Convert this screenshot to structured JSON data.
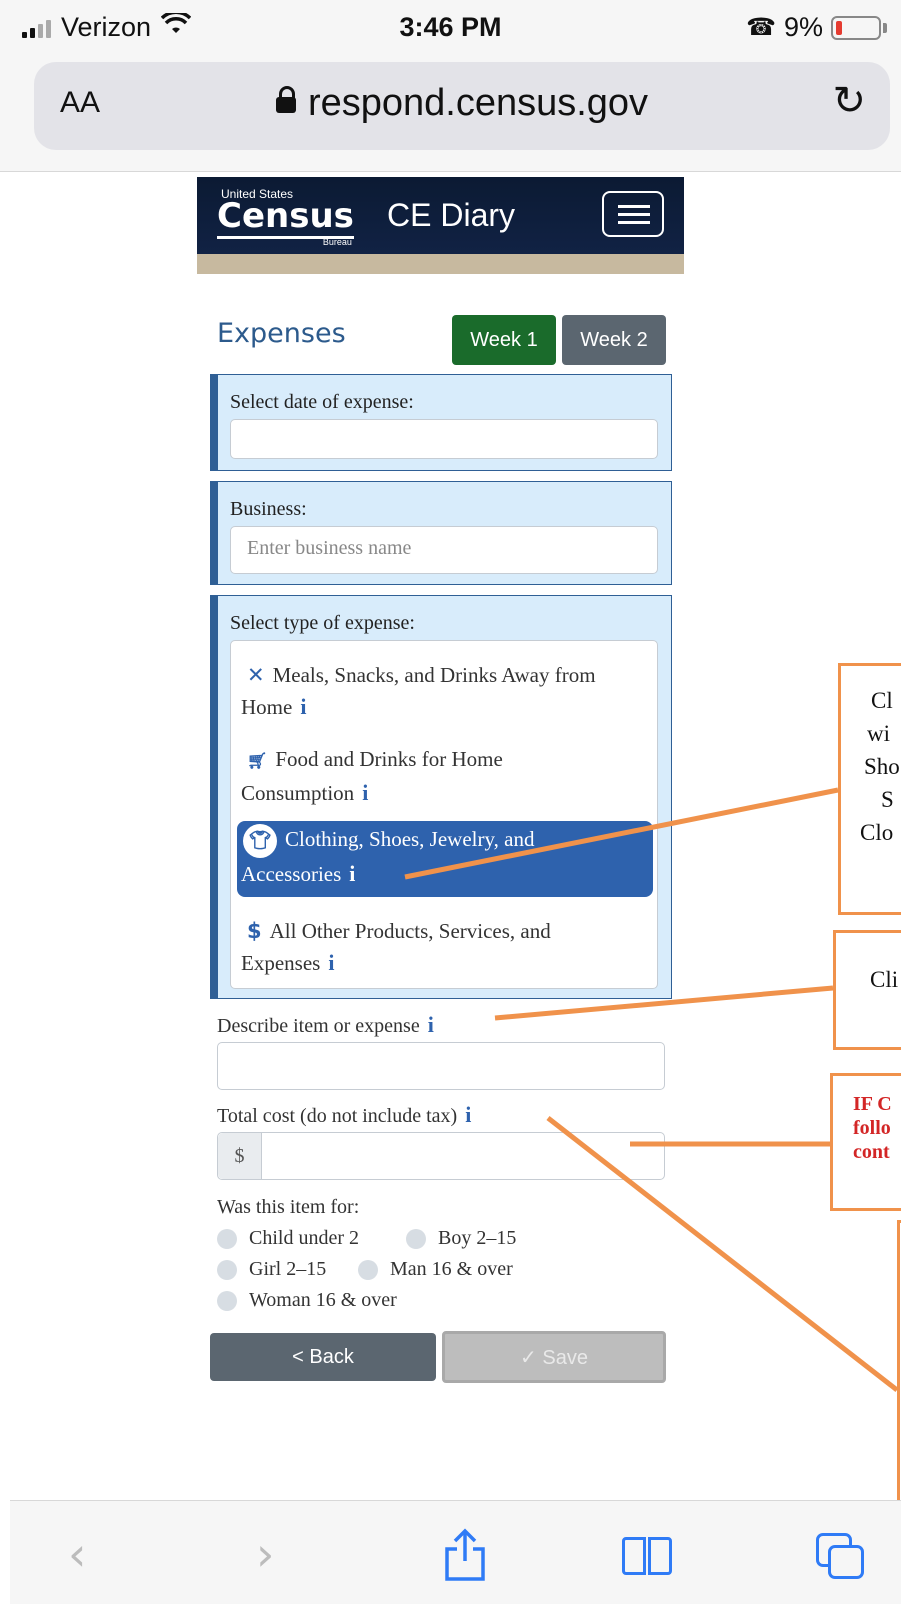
{
  "status_bar": {
    "carrier": "Verizon",
    "time": "3:46 PM",
    "battery": "9%"
  },
  "browser": {
    "text_size": "AA",
    "url": "respond.census.gov"
  },
  "header": {
    "logo_top": "United States",
    "logo_word": "Census",
    "logo_bottom": "Bureau",
    "app_title": "CE Diary"
  },
  "expenses": {
    "title": "Expenses",
    "week1": "Week 1",
    "week2": "Week 2",
    "date_label": "Select date of expense:",
    "date_value": "",
    "business_label": "Business:",
    "business_placeholder": "Enter business name",
    "type_label": "Select type of expense:",
    "types": [
      {
        "line1": "Meals, Snacks, and Drinks Away from",
        "line2": "Home",
        "icon": "utensils-icon"
      },
      {
        "line1": "Food and Drinks for Home",
        "line2": "Consumption",
        "icon": "cart-icon"
      },
      {
        "line1": "Clothing, Shoes, Jewelry, and",
        "line2": "Accessories",
        "icon": "shirt-icon",
        "selected": true
      },
      {
        "line1": "All Other Products, Services, and",
        "line2": "Expenses",
        "icon": "dollar-icon"
      }
    ],
    "info_glyph": "i",
    "describe_label": "Describe item or expense",
    "cost_label": "Total cost (do not include tax)",
    "currency": "$",
    "was_for_label": "Was this item for:",
    "recipients": [
      "Child under 2",
      "Boy 2–15",
      "Girl 2–15",
      "Man 16 & over",
      "Woman 16 & over"
    ],
    "back_label": "< Back",
    "save_label": "✓ Save"
  },
  "callouts": {
    "c1": [
      "Cl",
      "wi",
      "Sho",
      "S",
      "Clo"
    ],
    "c2": [
      "Cli"
    ],
    "c3": [
      "IF C",
      "follo",
      "cont"
    ]
  },
  "colors": {
    "accent_blue": "#2e62ad",
    "week1_green": "#1a6b2b",
    "callout_orange": "#f0924b"
  }
}
